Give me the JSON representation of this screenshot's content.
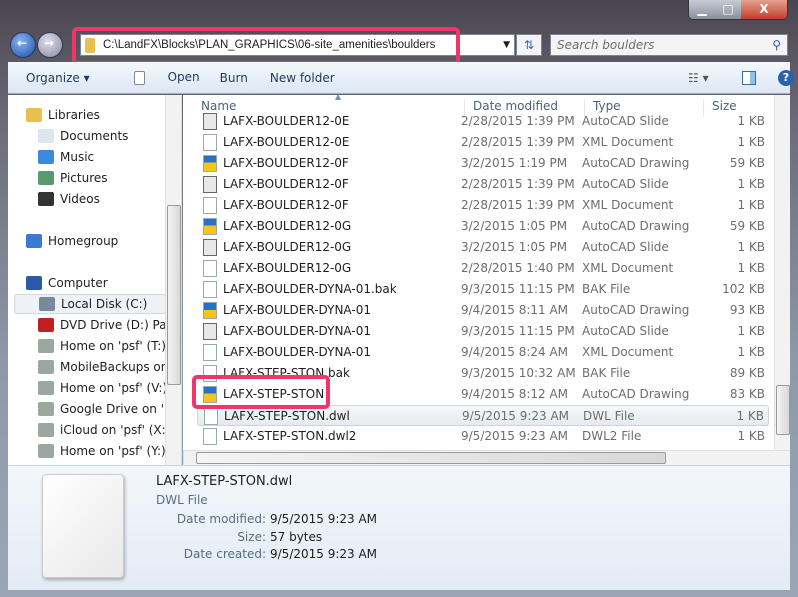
{
  "window": {
    "minimize": "▁",
    "maximize": "□",
    "close": "X"
  },
  "address": {
    "path": "C:\\LandFX\\Blocks\\PLAN_GRAPHICS\\06-site_amenities\\boulders"
  },
  "search": {
    "placeholder": "Search boulders"
  },
  "toolbar": {
    "organize": "Organize ▾",
    "open": "Open",
    "burn": "Burn",
    "new_folder": "New folder"
  },
  "nav": {
    "items": [
      {
        "label": "Libraries",
        "icon": "library-icon",
        "indent": 0
      },
      {
        "label": "Documents",
        "icon": "documents-icon",
        "indent": 1
      },
      {
        "label": "Music",
        "icon": "music-icon",
        "indent": 1
      },
      {
        "label": "Pictures",
        "icon": "pictures-icon",
        "indent": 1
      },
      {
        "label": "Videos",
        "icon": "videos-icon",
        "indent": 1
      },
      {
        "label": "Homegroup",
        "icon": "homegroup-icon",
        "indent": 0
      },
      {
        "label": "Computer",
        "icon": "computer-icon",
        "indent": 0
      },
      {
        "label": "Local Disk (C:)",
        "icon": "local-disk-icon",
        "indent": 1,
        "selected": true
      },
      {
        "label": "DVD Drive (D:) Parallels Tools",
        "icon": "dvd-drive-icon",
        "indent": 1
      },
      {
        "label": "Home on 'psf' (T:)",
        "icon": "network-drive-icon",
        "indent": 1
      },
      {
        "label": "MobileBackups on 'psf'",
        "icon": "network-drive-icon",
        "indent": 1
      },
      {
        "label": "Home on 'psf' (V:)",
        "icon": "network-drive-icon",
        "indent": 1
      },
      {
        "label": "Google Drive on 'psf'",
        "icon": "network-drive-icon",
        "indent": 1
      },
      {
        "label": "iCloud on 'psf' (X:)",
        "icon": "network-drive-icon",
        "indent": 1
      },
      {
        "label": "Home on 'psf' (Y:)",
        "icon": "network-drive-icon",
        "indent": 1
      }
    ]
  },
  "columns": {
    "name": "Name",
    "date": "Date modified",
    "type": "Type",
    "size": "Size"
  },
  "files": [
    {
      "name": "LAFX-BOULDER12-0E",
      "date": "2/28/2015 1:39 PM",
      "type": "AutoCAD Slide",
      "size": "1 KB",
      "icon": "sld"
    },
    {
      "name": "LAFX-BOULDER12-0E",
      "date": "2/28/2015 1:39 PM",
      "type": "XML Document",
      "size": "1 KB",
      "icon": "doc"
    },
    {
      "name": "LAFX-BOULDER12-0F",
      "date": "3/2/2015 1:19 PM",
      "type": "AutoCAD Drawing",
      "size": "59 KB",
      "icon": "dwg"
    },
    {
      "name": "LAFX-BOULDER12-0F",
      "date": "2/28/2015 1:39 PM",
      "type": "AutoCAD Slide",
      "size": "1 KB",
      "icon": "sld"
    },
    {
      "name": "LAFX-BOULDER12-0F",
      "date": "2/28/2015 1:39 PM",
      "type": "XML Document",
      "size": "1 KB",
      "icon": "doc"
    },
    {
      "name": "LAFX-BOULDER12-0G",
      "date": "3/2/2015 1:05 PM",
      "type": "AutoCAD Drawing",
      "size": "59 KB",
      "icon": "dwg"
    },
    {
      "name": "LAFX-BOULDER12-0G",
      "date": "3/2/2015 1:05 PM",
      "type": "AutoCAD Slide",
      "size": "1 KB",
      "icon": "sld"
    },
    {
      "name": "LAFX-BOULDER12-0G",
      "date": "2/28/2015 1:40 PM",
      "type": "XML Document",
      "size": "1 KB",
      "icon": "doc"
    },
    {
      "name": "LAFX-BOULDER-DYNA-01.bak",
      "date": "9/3/2015 11:15 PM",
      "type": "BAK File",
      "size": "102 KB",
      "icon": "doc"
    },
    {
      "name": "LAFX-BOULDER-DYNA-01",
      "date": "9/4/2015 8:11 AM",
      "type": "AutoCAD Drawing",
      "size": "93 KB",
      "icon": "dwg"
    },
    {
      "name": "LAFX-BOULDER-DYNA-01",
      "date": "9/3/2015 11:15 PM",
      "type": "AutoCAD Slide",
      "size": "1 KB",
      "icon": "sld"
    },
    {
      "name": "LAFX-BOULDER-DYNA-01",
      "date": "9/4/2015 8:24 AM",
      "type": "XML Document",
      "size": "1 KB",
      "icon": "doc"
    },
    {
      "name": "LAFX-STEP-STON.bak",
      "date": "9/3/2015 10:32 AM",
      "type": "BAK File",
      "size": "89 KB",
      "icon": "doc"
    },
    {
      "name": "LAFX-STEP-STON",
      "date": "9/4/2015 8:12 AM",
      "type": "AutoCAD Drawing",
      "size": "83 KB",
      "icon": "dwg",
      "highlighted": true
    },
    {
      "name": "LAFX-STEP-STON.dwl",
      "date": "9/5/2015 9:23 AM",
      "type": "DWL File",
      "size": "1 KB",
      "icon": "doc",
      "selected": true
    },
    {
      "name": "LAFX-STEP-STON.dwl2",
      "date": "9/5/2015 9:23 AM",
      "type": "DWL2 File",
      "size": "1 KB",
      "icon": "doc"
    }
  ],
  "details": {
    "name": "LAFX-STEP-STON.dwl",
    "type": "DWL File",
    "date_modified_label": "Date modified:",
    "date_modified": "9/5/2015 9:23 AM",
    "size_label": "Size:",
    "size": "57 bytes",
    "date_created_label": "Date created:",
    "date_created": "9/5/2015 9:23 AM"
  },
  "colors": {
    "highlight": "#f0356a",
    "selection": "#e8eef6"
  }
}
